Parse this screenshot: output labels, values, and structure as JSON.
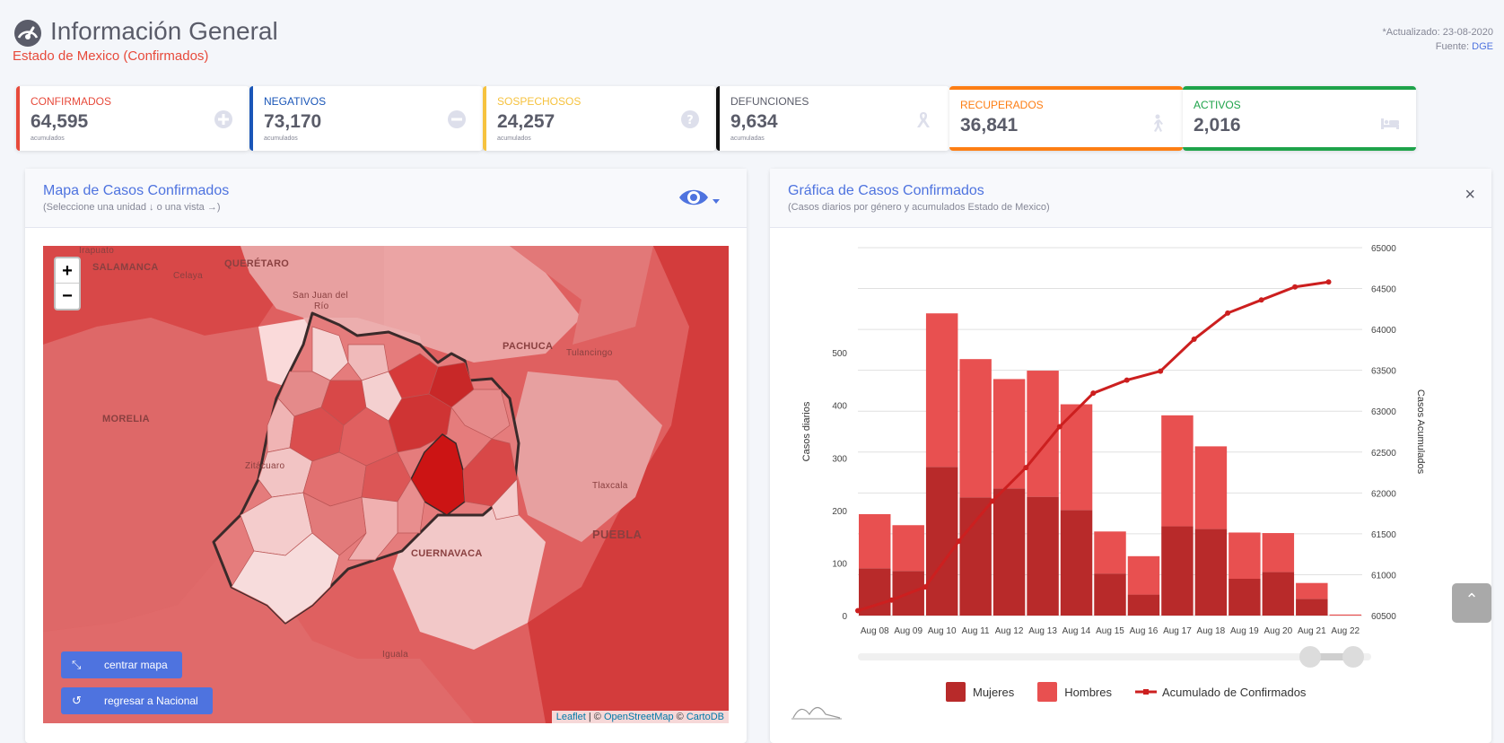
{
  "header": {
    "title": "Información General",
    "subtitle": "Estado de Mexico (Confirmados)",
    "updated": "*Actualizado: 23-08-2020",
    "source_label": "Fuente:",
    "source_link": "DGE"
  },
  "cards": [
    {
      "label": "CONFIRMADOS",
      "value": "64,595",
      "sub": "acumulados",
      "color": "#e74a3b",
      "icon": "plus-circle-icon"
    },
    {
      "label": "NEGATIVOS",
      "value": "73,170",
      "sub": "acumulados",
      "color": "#1a56b8",
      "icon": "minus-circle-icon"
    },
    {
      "label": "SOSPECHOSOS",
      "value": "24,257",
      "sub": "acumulados",
      "color": "#f6c23e",
      "icon": "question-circle-icon"
    },
    {
      "label": "DEFUNCIONES",
      "value": "9,634",
      "sub": "acumuladas",
      "color": "#111111",
      "icon": "ribbon-icon"
    },
    {
      "label": "RECUPERADOS",
      "value": "36,841",
      "sub": "",
      "color": "#fd7e14",
      "icon": "walking-icon"
    },
    {
      "label": "ACTIVOS",
      "value": "2,016",
      "sub": "",
      "color": "#1cc88a",
      "icon": "bed-icon"
    }
  ],
  "map_panel": {
    "title": "Mapa de Casos Confirmados",
    "subtitle": "(Seleccione una unidad ↓ o una vista →)",
    "zoom_in": "+",
    "zoom_out": "−",
    "btn_center": "centrar mapa",
    "btn_back": "regresar a Nacional",
    "attribution": {
      "leaflet": "Leaflet",
      "sep1": " | © ",
      "osm": "OpenStreetMap",
      "sep2": " © ",
      "carto": "CartoDB"
    },
    "labels": [
      "Irapuato",
      "SALAMANCA",
      "Celaya",
      "QUERÉTARO",
      "San Juan del",
      "Río",
      "PACHUCA",
      "Tulancingo",
      "MORELIA",
      "Zitácuaro",
      "Tlaxcala",
      "PUEBLA",
      "CUERNAVACA",
      "Iguala"
    ]
  },
  "chart_panel": {
    "title": "Gráfica de Casos Confirmados",
    "subtitle": "(Casos diarios por género y acumulados Estado de Mexico)",
    "close": "×"
  },
  "chart_data": {
    "type": "bar",
    "categories": [
      "Aug 08",
      "Aug 09",
      "Aug 10",
      "Aug 11",
      "Aug 12",
      "Aug 13",
      "Aug 14",
      "Aug 15",
      "Aug 16",
      "Aug 17",
      "Aug 18",
      "Aug 19",
      "Aug 20",
      "Aug 21",
      "Aug 22"
    ],
    "series": [
      {
        "name": "Mujeres",
        "type": "bar",
        "stack": true,
        "color": "#b82a2a",
        "values": [
          90,
          85,
          283,
          225,
          242,
          226,
          201,
          80,
          40,
          170,
          165,
          70,
          83,
          32,
          0
        ]
      },
      {
        "name": "Hombres",
        "type": "bar",
        "stack": true,
        "color": "#e85050",
        "values": [
          103,
          87,
          292,
          263,
          208,
          240,
          201,
          80,
          73,
          211,
          157,
          88,
          74,
          30,
          2
        ]
      },
      {
        "name": "Acumulado de Confirmados",
        "type": "line",
        "axis": "right",
        "color": "#cc1f1f",
        "values": [
          60560,
          60690,
          60850,
          61410,
          61900,
          62310,
          62810,
          63220,
          63380,
          63490,
          63880,
          64200,
          64360,
          64520,
          64580
        ]
      }
    ],
    "ylabel": "Casos diarios",
    "ylabel_right": "Casos Acumulados",
    "ylim": [
      0,
      700
    ],
    "yticks": [
      0,
      100,
      200,
      300,
      400,
      500
    ],
    "ylim_right": [
      60500,
      65000
    ],
    "yticks_right": [
      60500,
      61000,
      61500,
      62000,
      62500,
      63000,
      63500,
      64000,
      64500,
      65000
    ],
    "legend": "bottom"
  }
}
